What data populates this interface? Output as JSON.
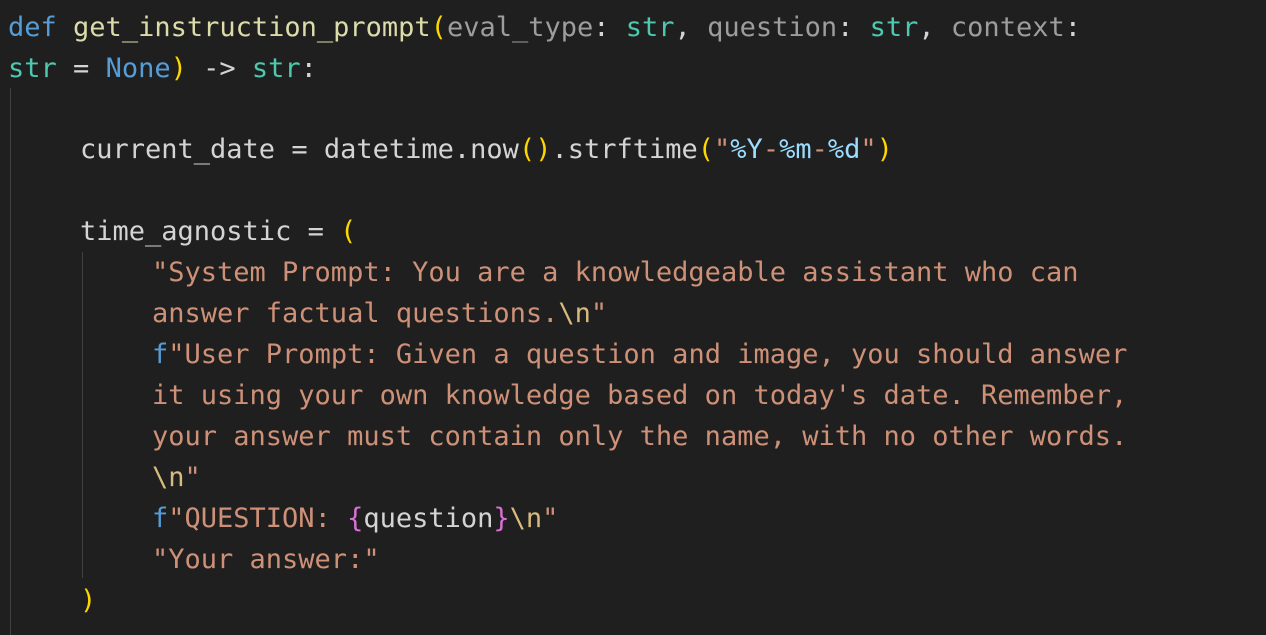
{
  "code": {
    "def_keyword": "def",
    "func_name": "get_instruction_prompt",
    "open_paren": "(",
    "param1": "eval_type",
    "colon1": ": ",
    "type1": "str",
    "comma1": ", ",
    "param2": "question",
    "colon2": ": ",
    "type2": "str",
    "comma2": ", ",
    "param3": "context",
    "colon3": ":",
    "type3": "str",
    "eq_none": " = ",
    "none_keyword": "None",
    "close_paren": ")",
    "arrow": " -> ",
    "ret_type": "str",
    "def_colon": ":",
    "cd_var": "current_date",
    "cd_eq": " = ",
    "cd_call1": "datetime.now",
    "cd_parens": "()",
    "cd_call2": ".strftime",
    "cd_open": "(",
    "cd_q1": "\"",
    "cd_fmt1": "%Y",
    "cd_dash1": "-",
    "cd_fmt2": "%m",
    "cd_dash2": "-",
    "cd_fmt3": "%d",
    "cd_q2": "\"",
    "cd_close": ")",
    "ta_var": "time_agnostic",
    "ta_eq": " = ",
    "ta_open": "(",
    "s1_line1": "\"System Prompt: You are a knowledgeable assistant who can",
    "s1_line2": "answer factual questions.",
    "s1_esc": "\\n",
    "s1_end": "\"",
    "s2_prefix": "f",
    "s2_line1": "\"User Prompt: Given a question and image, you should answer",
    "s2_line2": "it using your own knowledge based on today's date. Remember,",
    "s2_line3": "your answer must contain only the name, with no other words.",
    "s2_esc": "\\n",
    "s2_end": "\"",
    "s3_prefix": "f",
    "s3_text": "\"QUESTION: ",
    "s3_lbrace": "{",
    "s3_var": "question",
    "s3_rbrace": "}",
    "s3_esc": "\\n",
    "s3_end": "\"",
    "s4_text": "\"Your answer:\"",
    "ta_close": ")"
  },
  "colors": {
    "background": "#1f1f1f",
    "keyword": "#569cd6",
    "function": "#dcdcaa",
    "type": "#4ec9b0",
    "string": "#ce9178",
    "bracket_level1": "#ffd700",
    "bracket_level2": "#da70d6"
  }
}
